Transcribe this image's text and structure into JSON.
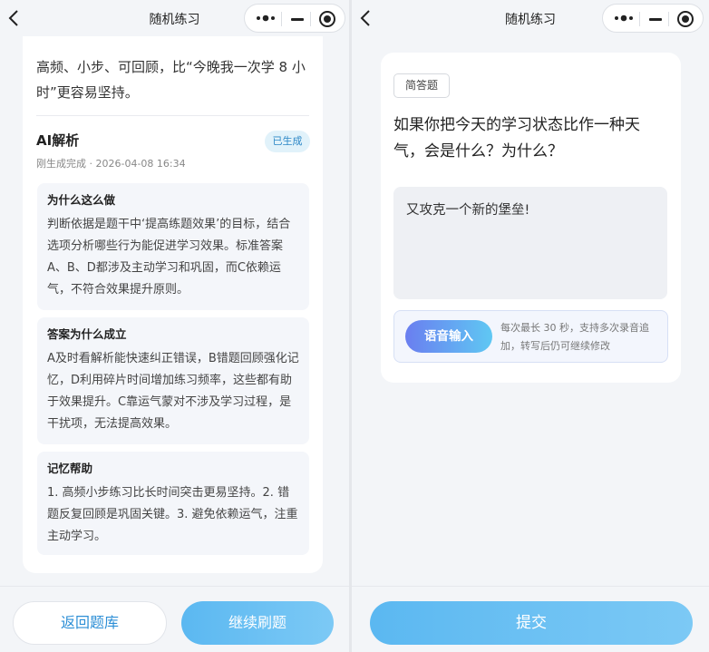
{
  "left": {
    "nav": {
      "title": "随机练习"
    },
    "intro_text": "高频、小步、可回顾，比“今晚我一次学 8 小时”更容易坚持。",
    "ai": {
      "title": "AI解析",
      "badge": "已生成",
      "meta": "刚生成完成 · 2026-04-08 16:34"
    },
    "sections": [
      {
        "title": "为什么这么做",
        "body": "判断依据是题干中‘提高练题效果’的目标，结合选项分析哪些行为能促进学习效果。标准答案A、B、D都涉及主动学习和巩固，而C依赖运气，不符合效果提升原则。"
      },
      {
        "title": "答案为什么成立",
        "body": "A及时看解析能快速纠正错误，B错题回顾强化记忆，D利用碎片时间增加练习频率，这些都有助于效果提升。C靠运气蒙对不涉及学习过程，是干扰项，无法提高效果。"
      },
      {
        "title": "记忆帮助",
        "body": "1. 高频小步练习比长时间突击更易坚持。2. 错题反复回顾是巩固关键。3. 避免依赖运气，注重主动学习。"
      }
    ],
    "buttons": {
      "back": "返回题库",
      "next": "继续刷题"
    }
  },
  "right": {
    "nav": {
      "title": "随机练习"
    },
    "question_type": "简答题",
    "question": "如果你把今天的学习状态比作一种天气，会是什么？为什么？",
    "answer": "又攻克一个新的堡垒!",
    "voice": {
      "button": "语音输入",
      "tip": "每次最长 30 秒，支持多次录音追加，转写后仍可继续修改"
    },
    "submit": "提交"
  },
  "icons": {
    "back": "chevron-left-icon",
    "more": "more-dots-icon",
    "minimize": "minimize-icon",
    "close": "record-close-icon"
  },
  "colors": {
    "accent": "#5bb8f1",
    "accent_text": "#2d8fd6",
    "badge_bg": "#e1f2fa",
    "voice_gradient_start": "#6a7ef0",
    "voice_gradient_end": "#5fc8f3"
  }
}
